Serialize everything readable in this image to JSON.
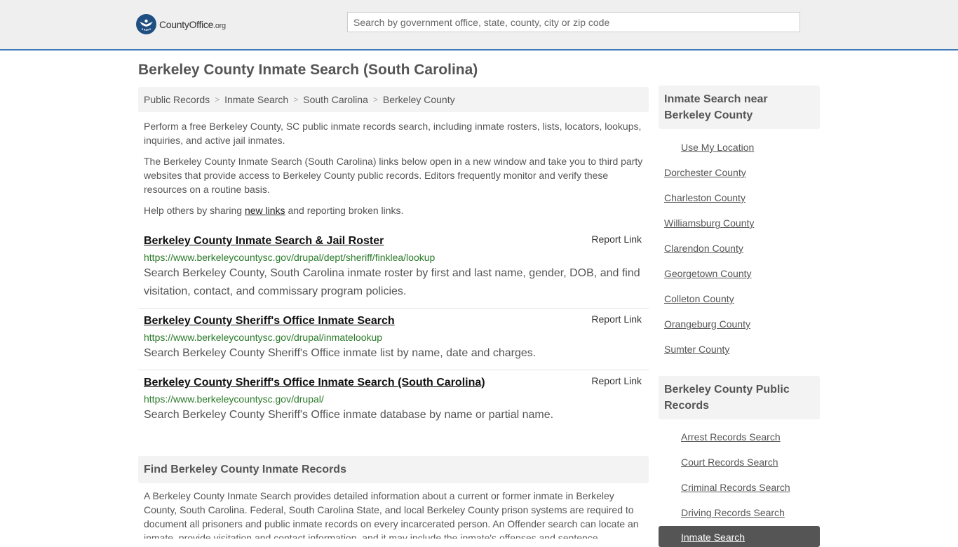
{
  "header": {
    "logo_county": "County",
    "logo_office": "Office",
    "logo_org": ".org",
    "search_placeholder": "Search by government office, state, county, city or zip code"
  },
  "page_title": "Berkeley County Inmate Search (South Carolina)",
  "breadcrumb": [
    "Public Records",
    "Inmate Search",
    "South Carolina",
    "Berkeley County"
  ],
  "breadcrumb_sep": ">",
  "intro": {
    "p1": "Perform a free Berkeley County, SC public inmate records search, including inmate rosters, lists, locators, lookups, inquiries, and active jail inmates.",
    "p2": "The Berkeley County Inmate Search (South Carolina) links below open in a new window and take you to third party websites that provide access to Berkeley County public records. Editors frequently monitor and verify these resources on a routine basis.",
    "p3_before": "Help others by sharing ",
    "p3_link": "new links",
    "p3_after": " and reporting broken links."
  },
  "report_label": "Report Link",
  "results": [
    {
      "title": "Berkeley County Inmate Search & Jail Roster",
      "url": "https://www.berkeleycountysc.gov/drupal/dept/sheriff/finklea/lookup",
      "desc": "Search Berkeley County, South Carolina inmate roster by first and last name, gender, DOB, and find visitation, contact, and commissary program policies."
    },
    {
      "title": "Berkeley County Sheriff's Office Inmate Search",
      "url": "https://www.berkeleycountysc.gov/drupal/inmatelookup",
      "desc": "Search Berkeley County Sheriff's Office inmate list by name, date and charges."
    },
    {
      "title": "Berkeley County Sheriff's Office Inmate Search (South Carolina)",
      "url": "https://www.berkeleycountysc.gov/drupal/",
      "desc": "Search Berkeley County Sheriff's Office inmate database by name or partial name."
    }
  ],
  "find": {
    "heading": "Find Berkeley County Inmate Records",
    "body": "A Berkeley County Inmate Search provides detailed information about a current or former inmate in Berkeley County, South Carolina. Federal, South Carolina State, and local Berkeley County prison systems are required to document all prisoners and public inmate records on every incarcerated person. An Offender search can locate an inmate, provide visitation and contact information, and it may include the inmate's offenses and sentence."
  },
  "sidebar": {
    "nearby_heading": "Inmate Search near Berkeley County",
    "use_location": "Use My Location",
    "nearby": [
      "Dorchester County",
      "Charleston County",
      "Williamsburg County",
      "Clarendon County",
      "Georgetown County",
      "Colleton County",
      "Orangeburg County",
      "Sumter County"
    ],
    "records_heading": "Berkeley County Public Records",
    "records": [
      "Arrest Records Search",
      "Court Records Search",
      "Criminal Records Search",
      "Driving Records Search"
    ],
    "active": "Inmate Search"
  },
  "colors": {
    "header_bg": "#efefef",
    "header_border": "#3d7ab8",
    "url_green": "#2a7a2a",
    "logo_blue": "#1f4f82"
  }
}
